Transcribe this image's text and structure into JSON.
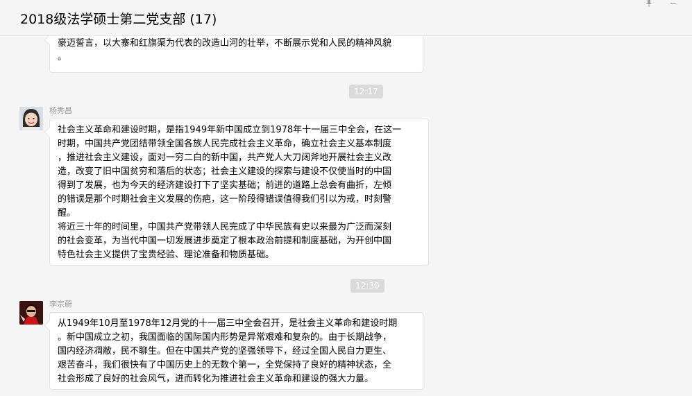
{
  "window": {
    "title": "2018级法学硕士第二党支部 (17)",
    "pin_icon": "pin-icon",
    "minimize_icon": "minimize-icon"
  },
  "messages": [
    {
      "id": "prev",
      "lines": [
        "豪迈誓言，以大寨和红旗渠为代表的改造山河的壮举，不断展示党和人民的精神风貌",
        "。"
      ]
    },
    {
      "id": "m1",
      "time": "12:17",
      "sender": "杨秀昌",
      "lines": [
        "社会主义革命和建设时期，是指1949年新中国成立到1978年十一届三中全会，在这一",
        "时期，中国共产党团结带领全国各族人民完成社会主义革命，确立社会主义基本制度",
        "，推进社会主义建设，面对一穷二白的新中国，共产党人大刀阔斧地开展社会主义改",
        "造，改变了旧中国贫穷和落后的状态；社会主义建设的探索与建设不仅使当时的中国",
        "得到了发展，也为今天的经济建设打下了坚实基础；前进的道路上总会有曲折，左倾",
        "的错误是那个时期社会主义发展的伤疤，这一阶段得错误值得我们引以为戒，时刻警",
        "醒。",
        "将近三十年的时间里，中国共产党带领人民完成了中华民族有史以来最为广泛而深刻",
        "的社会变革，为当代中国一切发展进步奠定了根本政治前提和制度基础，为开创中国",
        "特色社会主义提供了宝贵经验、理论准备和物质基础。"
      ]
    },
    {
      "id": "m2",
      "time": "12:30",
      "sender": "李宗蔚",
      "lines": [
        "从1949年10月至1978年12月党的十一届三中全会召开，是社会主义革命和建设时期",
        "。新中国成立之初，我国面临的国际国内形势是异常艰难和复杂的。由于长期战争，",
        "国内经济凋敝，民不聊生。但在中国共产党的坚强领导下，经过全国人民自力更生、",
        "艰苦奋斗，我们很快有了中国历史上的无数个第一，全党保持了良好的精神状态，全",
        "社会形成了良好的社会风气，进而转化为推进社会主义革命和建设的强大力量。"
      ]
    }
  ]
}
